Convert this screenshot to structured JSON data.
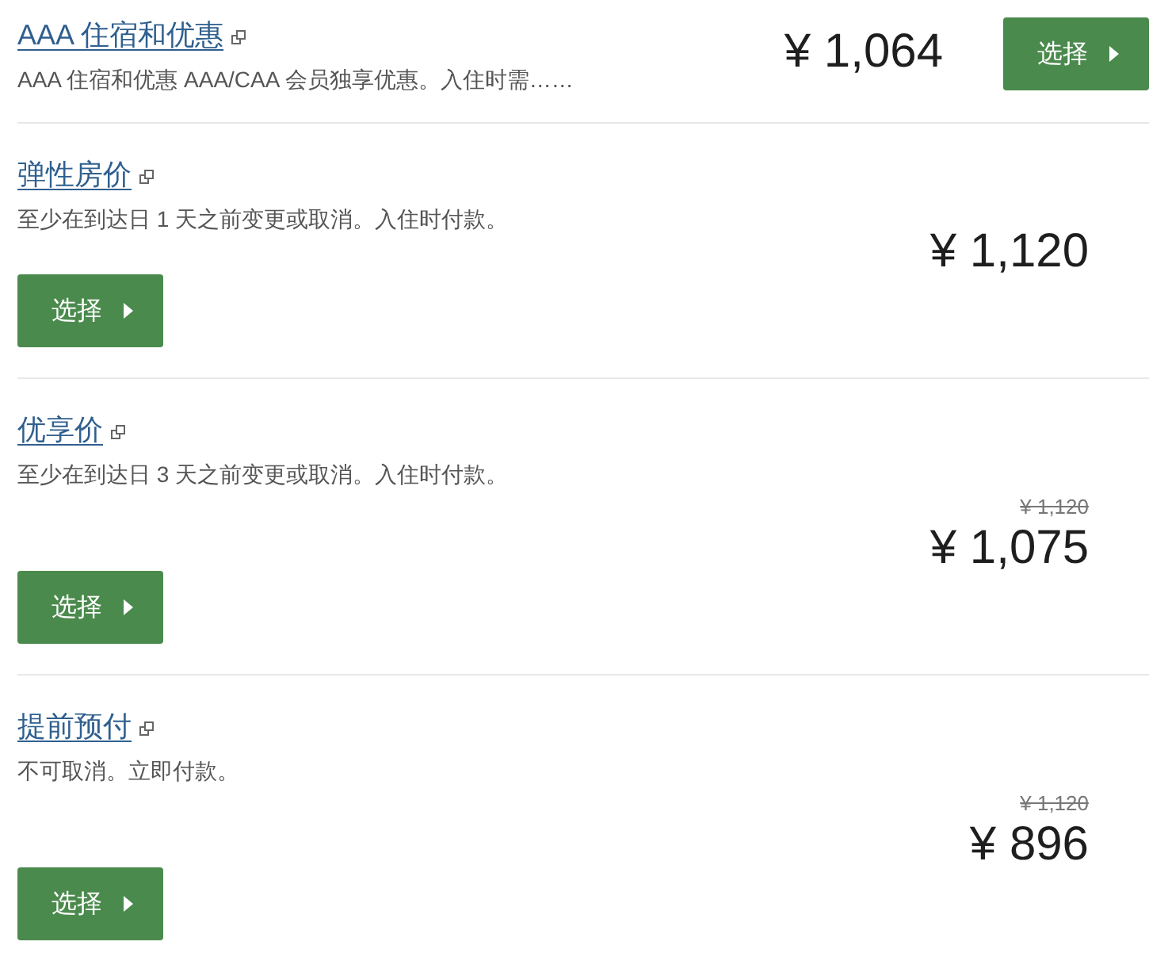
{
  "offers": [
    {
      "kind": "inline",
      "title": "AAA 住宿和优惠",
      "description": "AAA 住宿和优惠 AAA/CAA 会员独享优惠。入住时需……",
      "price": "¥ 1,064",
      "button": "选择"
    },
    {
      "kind": "stacked",
      "title": "弹性房价",
      "description": "至少在到达日 1 天之前变更或取消。入住时付款。",
      "price": "¥ 1,120",
      "button": "选择"
    },
    {
      "kind": "stacked",
      "title": "优享价",
      "description": "至少在到达日 3 天之前变更或取消。入住时付款。",
      "original_price": "¥ 1,120",
      "price": "¥ 1,075",
      "button": "选择"
    },
    {
      "kind": "stacked",
      "title": "提前预付",
      "description": "不可取消。立即付款。",
      "original_price": "¥ 1,120",
      "price": "¥ 896",
      "button": "选择"
    }
  ]
}
